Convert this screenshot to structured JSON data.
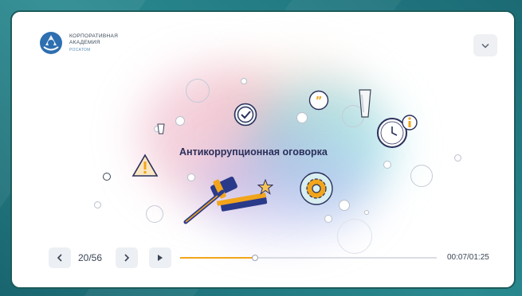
{
  "logo": {
    "line1": "КОРПОРАТИВНАЯ",
    "line2": "АКАДЕМИЯ",
    "line3": "РОСАТОМ"
  },
  "dropdown": {
    "icon": "chevron-down-icon"
  },
  "slide": {
    "title": "Антикоррупционная оговорка"
  },
  "player": {
    "counter": "20/56",
    "time": "00:07/01:25",
    "progress": 0.29,
    "prev_icon": "chevron-left-icon",
    "next_icon": "chevron-right-icon",
    "play_icon": "play-icon"
  },
  "colors": {
    "accent": "#f2a51b",
    "title": "#2a2f5a",
    "frame_border": "#1c5b5b"
  }
}
